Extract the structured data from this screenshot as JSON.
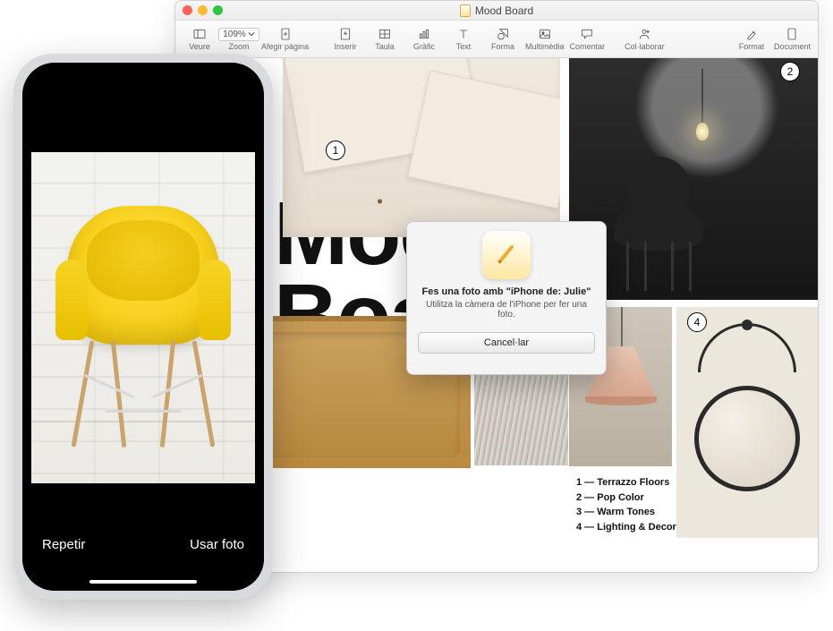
{
  "window": {
    "title": "Mood Board",
    "toolbar": {
      "view": "Veure",
      "zoom_label": "Zoom",
      "zoom_value": "109%",
      "add_page": "Afegir pàgina",
      "insert": "Inserir",
      "table": "Taula",
      "chart": "Gràfic",
      "text": "Text",
      "shape": "Forma",
      "media": "Multimèdia",
      "comment": "Comentar",
      "collaborate": "Col·laborar",
      "format": "Format",
      "document": "Document"
    }
  },
  "document": {
    "headline_line1": "Mood",
    "headline_line2": "Board.",
    "legend": [
      "1  —  Terrazzo Floors",
      "2  —  Pop Color",
      "3  —  Warm Tones",
      "4  —  Lighting & Decor"
    ],
    "callouts": {
      "c1": "1",
      "c2": "2",
      "c4": "4"
    }
  },
  "modal": {
    "title": "Fes una foto amb \"iPhone de: Julie\"",
    "subtitle": "Utilitza la càmera de l'iPhone per fer una foto.",
    "cancel": "Cancel·lar"
  },
  "iphone": {
    "retake": "Repetir",
    "use_photo": "Usar foto"
  }
}
